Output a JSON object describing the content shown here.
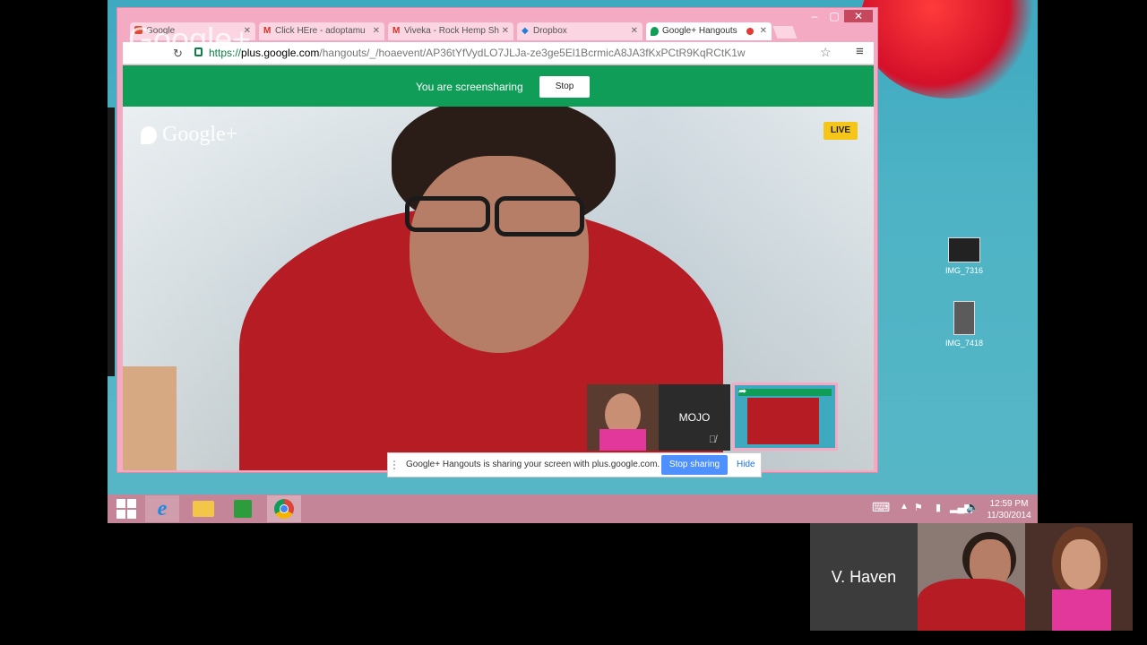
{
  "window": {
    "tabs": [
      {
        "label": "Google",
        "icon": "gplus-icon"
      },
      {
        "label": "Click HEre - adoptamu",
        "icon": "gmail-icon"
      },
      {
        "label": "Viveka - Rock Hemp Sh",
        "icon": "gmail-icon"
      },
      {
        "label": "Dropbox",
        "icon": "dropbox-icon"
      },
      {
        "label": "Google+ Hangouts",
        "icon": "hangouts-icon"
      }
    ],
    "url_scheme": "https://",
    "url_domain": "plus.google.com",
    "url_path": "/hangouts/_/hoaevent/AP36tYfVydLO7JLJa-ze3ge5El1BcrmicA8JA3fKxPCtR9KqRCtK1w",
    "watermark": "Google+"
  },
  "screenshare": {
    "message": "You are screensharing",
    "stop_label": "Stop"
  },
  "hangout": {
    "brand": "Google+",
    "live_badge": "LIVE",
    "participant_mojo": "MOJO"
  },
  "share_notice": {
    "text": "Google+ Hangouts is sharing your screen with plus.google.com.",
    "stop_sharing_label": "Stop sharing",
    "hide_label": "Hide"
  },
  "desktop_icons": [
    {
      "label": "IMG_7316"
    },
    {
      "label": "IMG_7418"
    }
  ],
  "taskbar": {
    "time": "12:59 PM",
    "date": "11/30/2014"
  },
  "participants": {
    "name_tile": "V. Haven"
  },
  "colors": {
    "green_bar": "#0f9d58",
    "live_badge": "#f5c518",
    "stop_sharing_button": "#4d90fe",
    "window_frame": "#f5aac4"
  }
}
